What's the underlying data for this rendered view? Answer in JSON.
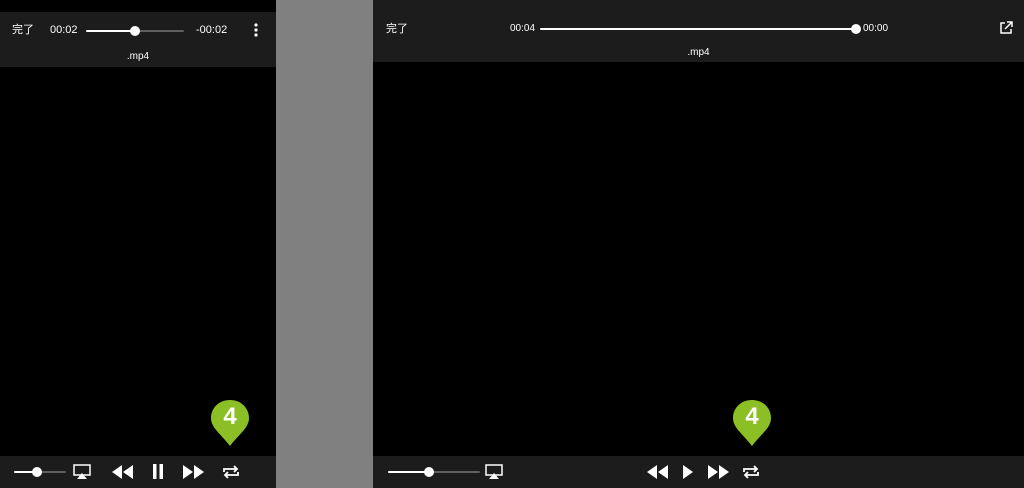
{
  "left_player": {
    "done_label": "完了",
    "elapsed": "00:02",
    "remaining": "-00:02",
    "seek_progress": 0.5,
    "filename": ".mp4",
    "volume_level": 0.45,
    "callout_number": "4",
    "icons": {
      "more": "more-vertical-icon",
      "airplay": "airplay-icon",
      "rewind": "rewind-icon",
      "pause": "pause-icon",
      "fast_forward": "fast-forward-icon",
      "repeat": "repeat-icon"
    }
  },
  "right_player": {
    "done_label": "完了",
    "elapsed": "00:04",
    "remaining": "00:00",
    "seek_progress": 1.0,
    "filename": ".mp4",
    "volume_level": 0.45,
    "callout_number": "4",
    "icons": {
      "share": "open-external-icon",
      "airplay": "airplay-icon",
      "rewind": "rewind-icon",
      "play": "play-icon",
      "fast_forward": "fast-forward-icon",
      "repeat": "repeat-icon"
    }
  },
  "colors": {
    "player_bg": "#000000",
    "bar_bg": "#1c1c1c",
    "divider_bg": "#808080",
    "track_bg": "#5f5f5f",
    "callout_green": "#8cbf26"
  }
}
